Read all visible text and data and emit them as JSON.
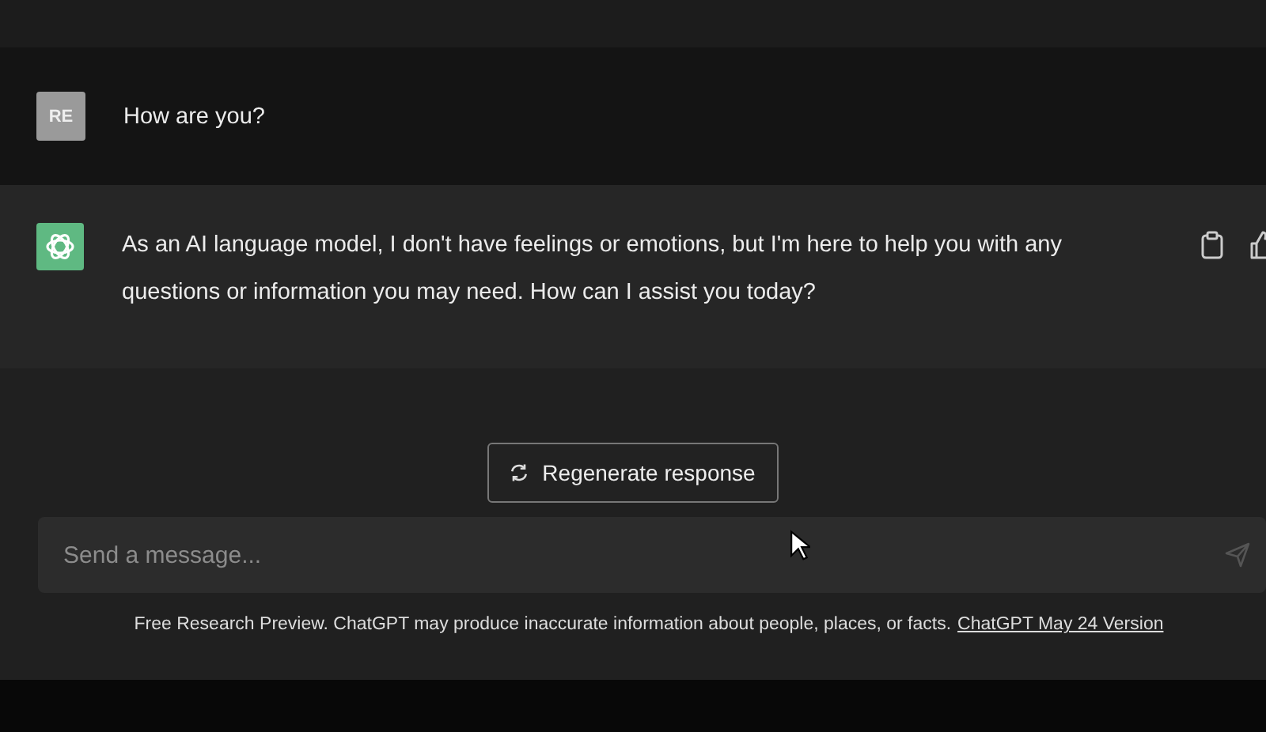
{
  "messages": [
    {
      "kind": "user",
      "avatar": "RE",
      "text": "How are you?"
    },
    {
      "kind": "assistant",
      "text": "As an AI language model, I don't have feelings or emotions, but I'm here to help you with any questions or information you may need. How can I assist you today?"
    }
  ],
  "regenerate_button": {
    "label": "Regenerate response"
  },
  "composer": {
    "placeholder": "Send a message..."
  },
  "footer": {
    "text": "Free Research Preview. ChatGPT may produce inaccurate information about people, places, or facts.",
    "link": "ChatGPT May 24 Version"
  }
}
